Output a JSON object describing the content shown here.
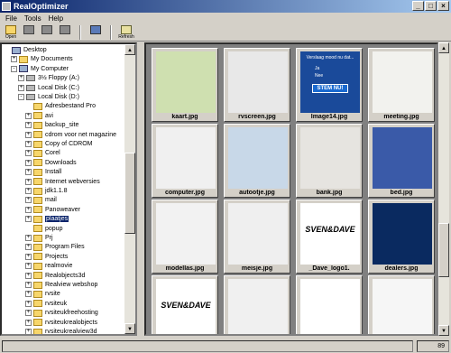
{
  "window": {
    "title": "RealOptimizer"
  },
  "menu": {
    "items": [
      "File",
      "Tools",
      "Help"
    ]
  },
  "toolbar": {
    "buttons": [
      "Open",
      "",
      "",
      "",
      "",
      "Refresh"
    ]
  },
  "tree": {
    "items": [
      {
        "label": "Desktop",
        "icon": "desktop-icon",
        "expander": "",
        "level": 0
      },
      {
        "label": "My Documents",
        "icon": "folder-icon",
        "expander": "+",
        "level": 1
      },
      {
        "label": "My Computer",
        "icon": "computer-icon",
        "expander": "-",
        "level": 1
      },
      {
        "label": "3½ Floppy (A:)",
        "icon": "floppy-icon",
        "expander": "+",
        "level": 2
      },
      {
        "label": "Local Disk (C:)",
        "icon": "drive-icon",
        "expander": "+",
        "level": 2
      },
      {
        "label": "Local Disk (D:)",
        "icon": "drive-icon",
        "expander": "-",
        "level": 2
      },
      {
        "label": "Adresbestand Pro",
        "icon": "folder-icon",
        "expander": "",
        "level": 3
      },
      {
        "label": "avi",
        "icon": "folder-icon",
        "expander": "+",
        "level": 3
      },
      {
        "label": "backup_site",
        "icon": "folder-icon",
        "expander": "+",
        "level": 3
      },
      {
        "label": "cdrom voor net magazine",
        "icon": "folder-icon",
        "expander": "+",
        "level": 3
      },
      {
        "label": "Copy of CDROM",
        "icon": "folder-icon",
        "expander": "+",
        "level": 3
      },
      {
        "label": "Corel",
        "icon": "folder-icon",
        "expander": "+",
        "level": 3
      },
      {
        "label": "Downloads",
        "icon": "folder-icon",
        "expander": "+",
        "level": 3
      },
      {
        "label": "Install",
        "icon": "folder-icon",
        "expander": "+",
        "level": 3
      },
      {
        "label": "Internet webversies",
        "icon": "folder-icon",
        "expander": "+",
        "level": 3
      },
      {
        "label": "jdk1.1.8",
        "icon": "folder-icon",
        "expander": "+",
        "level": 3
      },
      {
        "label": "mail",
        "icon": "folder-icon",
        "expander": "+",
        "level": 3
      },
      {
        "label": "Panoweaver",
        "icon": "folder-icon",
        "expander": "+",
        "level": 3
      },
      {
        "label": "plaatjes",
        "icon": "folder-icon",
        "expander": "+",
        "level": 3,
        "selected": true
      },
      {
        "label": "popup",
        "icon": "folder-icon",
        "expander": "",
        "level": 3
      },
      {
        "label": "Prj",
        "icon": "folder-icon",
        "expander": "+",
        "level": 3
      },
      {
        "label": "Program Files",
        "icon": "folder-icon",
        "expander": "+",
        "level": 3
      },
      {
        "label": "Projects",
        "icon": "folder-icon",
        "expander": "+",
        "level": 3
      },
      {
        "label": "realmovie",
        "icon": "folder-icon",
        "expander": "+",
        "level": 3
      },
      {
        "label": "Realobjects3d",
        "icon": "folder-icon",
        "expander": "+",
        "level": 3
      },
      {
        "label": "Realview webshop",
        "icon": "folder-icon",
        "expander": "+",
        "level": 3
      },
      {
        "label": "rvsite",
        "icon": "folder-icon",
        "expander": "+",
        "level": 3
      },
      {
        "label": "rvsiteuk",
        "icon": "folder-icon",
        "expander": "+",
        "level": 3
      },
      {
        "label": "rvsiteukfreehosting",
        "icon": "folder-icon",
        "expander": "+",
        "level": 3
      },
      {
        "label": "rvsiteukrealobjects",
        "icon": "folder-icon",
        "expander": "+",
        "level": 3
      },
      {
        "label": "rvsiteukrealview3d",
        "icon": "folder-icon",
        "expander": "+",
        "level": 3
      }
    ]
  },
  "gallery": {
    "thumbnails": [
      {
        "name": "kaart.jpg",
        "bg": "#cfe0b0"
      },
      {
        "name": "rvscreen.jpg",
        "bg": "#e8e8e8"
      },
      {
        "name": "Image14.jpg",
        "bg": "#1a4a9a"
      },
      {
        "name": "meeting.jpg",
        "bg": "#f2f2ee"
      },
      {
        "name": "computer.jpg",
        "bg": "#f0f0f0"
      },
      {
        "name": "autootje.jpg",
        "bg": "#c8d8e8"
      },
      {
        "name": "bank.jpg",
        "bg": "#e6e4e0"
      },
      {
        "name": "bed.jpg",
        "bg": "#3a5aa8"
      },
      {
        "name": "modellas.jpg",
        "bg": "#f2f2f2"
      },
      {
        "name": "meisje.jpg",
        "bg": "#efefef"
      },
      {
        "name": "_Dave_logo1.",
        "bg": "#ffffff"
      },
      {
        "name": "dealers.jpg",
        "bg": "#0a2a60"
      },
      {
        "name": "",
        "bg": "#ffffff"
      },
      {
        "name": "",
        "bg": "#f0f0f0"
      },
      {
        "name": "",
        "bg": "#ffffff"
      },
      {
        "name": "",
        "bg": "#f6f6f6"
      }
    ]
  },
  "overlay_text": {
    "image14_heading": "Verslaag mood nu dat...",
    "image14_opt1": "Ja",
    "image14_opt2": "Nee",
    "image14_button": "STEM NU!",
    "dave_logo": "SVEN&DAVE"
  },
  "status": {
    "count": "89"
  }
}
